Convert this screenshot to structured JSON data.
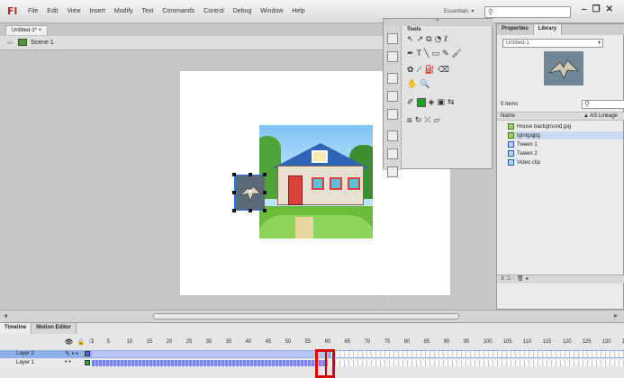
{
  "app": {
    "logo": "Fl"
  },
  "menu": [
    "File",
    "Edit",
    "View",
    "Insert",
    "Modify",
    "Text",
    "Commands",
    "Control",
    "Debug",
    "Window",
    "Help"
  ],
  "workspace": {
    "label": "Essentials",
    "caret": "▾"
  },
  "search": {
    "icon": "search-icon",
    "placeholder": ""
  },
  "window_buttons": [
    "–",
    "❐",
    "✕"
  ],
  "document": {
    "tab": "Untitled-1* ×",
    "scene": "Scene 1"
  },
  "tools_panel": {
    "title": "Tools",
    "drag_marker": "»"
  },
  "library": {
    "tabs": [
      "Properties",
      "Library"
    ],
    "document_select": "Untitled-1",
    "item_count": "5 items",
    "columns": {
      "name": "Name",
      "linkage": "▲ AS Linkage"
    },
    "items": [
      {
        "name": "House background.jpg",
        "type": "bitmap"
      },
      {
        "name": "Iginigajpg",
        "type": "bitmap"
      },
      {
        "name": "Tween 1",
        "type": "tween"
      },
      {
        "name": "Tween 2",
        "type": "tween"
      },
      {
        "name": "Video clip",
        "type": "video"
      }
    ],
    "footer": "⊻ ⊐ ◌ 🗑 ◂"
  },
  "timeline": {
    "tabs": [
      "Timeline",
      "Motion Editor"
    ],
    "header_icons": [
      "👁",
      "🔒",
      "□"
    ],
    "frame_numbers": [
      "1",
      "5",
      "10",
      "15",
      "20",
      "25",
      "30",
      "35",
      "40",
      "45",
      "50",
      "55",
      "60",
      "65",
      "70",
      "75",
      "80",
      "85",
      "90",
      "95",
      "100",
      "105",
      "110",
      "115",
      "120",
      "125",
      "130",
      "135"
    ],
    "layers": [
      {
        "name": "Layer 2",
        "selected": true
      },
      {
        "name": "Layer 1",
        "selected": false
      }
    ],
    "current_frame": 60,
    "tween_end_frame": 60
  },
  "colors": {
    "accent": "#e10000",
    "selection": "#2a6ff0",
    "layer_selected": "#8fb0e8",
    "tween": "#b9c4f5"
  }
}
